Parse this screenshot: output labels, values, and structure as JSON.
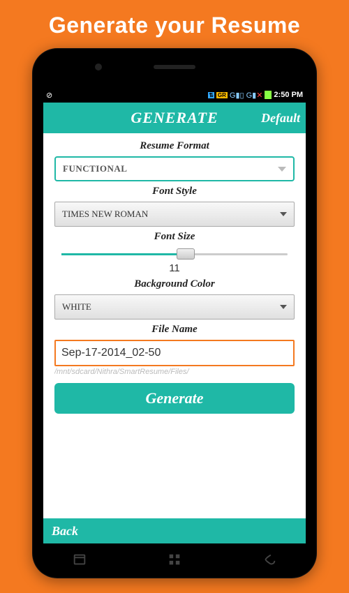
{
  "promo": {
    "title": "Generate your Resume"
  },
  "statusbar": {
    "time": "2:50 PM"
  },
  "appbar": {
    "title": "GENERATE",
    "right": "Default"
  },
  "form": {
    "resume_format": {
      "label": "Resume Format",
      "value": "FUNCTIONAL"
    },
    "font_style": {
      "label": "Font Style",
      "value": "TIMES NEW ROMAN"
    },
    "font_size": {
      "label": "Font Size",
      "value": "11"
    },
    "background_color": {
      "label": "Background Color",
      "value": "WHITE"
    },
    "file_name": {
      "label": "File Name",
      "value": "Sep-17-2014_02-50",
      "path": "/mnt/sdcard/Nithra/SmartResume/Files/"
    }
  },
  "buttons": {
    "generate": "Generate",
    "back": "Back"
  }
}
